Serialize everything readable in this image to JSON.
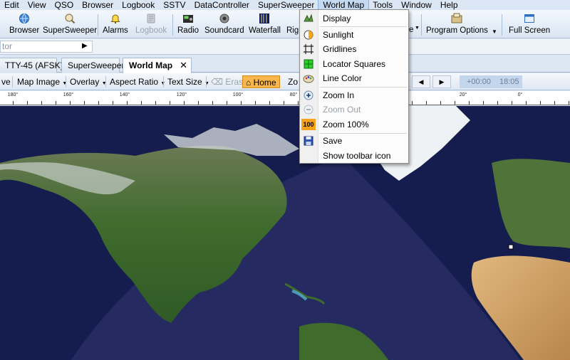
{
  "menubar": [
    "Edit",
    "View",
    "QSO",
    "Browser",
    "Logbook",
    "SSTV",
    "DataController",
    "SuperSweeper",
    "World Map",
    "Tools",
    "Window",
    "Help"
  ],
  "menubar_active": "World Map",
  "toolbar": {
    "browser": "Browser",
    "supersweeper": "SuperSweeper",
    "alarms": "Alarms",
    "logbook": "Logbook",
    "radio": "Radio",
    "soundcard": "Soundcard",
    "waterfall": "Waterfall",
    "rig": "Rig",
    "program_options": "Program Options",
    "full_screen": "Full Screen",
    "overflow_e": "e"
  },
  "address": {
    "placeholder": "tor"
  },
  "tabs": [
    "TTY-45 (AFSK)",
    "SuperSweeper",
    "World Map"
  ],
  "active_tab": "World Map",
  "map_toolbar": {
    "save": "ve",
    "map_image": "Map Image",
    "overlay": "Overlay",
    "aspect_ratio": "Aspect Ratio",
    "text_size": "Text Size",
    "erase": "Erase",
    "home": "Home",
    "zoom": "Zo",
    "time_offset": "+00:00",
    "time": "18:05"
  },
  "ruler_labels": [
    "180°",
    "160°",
    "140°",
    "120°",
    "100°",
    "80°",
    "20°",
    "0°"
  ],
  "world_map_menu": {
    "items": [
      {
        "label": "Display",
        "icon": "display-icon",
        "enabled": true
      },
      {
        "label": "Sunlight",
        "icon": "sunlight-icon",
        "enabled": true
      },
      {
        "label": "Gridlines",
        "icon": "gridlines-icon",
        "enabled": true
      },
      {
        "label": "Locator Squares",
        "icon": "locator-squares-icon",
        "enabled": true
      },
      {
        "label": "Line Color",
        "icon": "line-color-icon",
        "enabled": true
      },
      {
        "label": "Zoom In",
        "icon": "zoom-in-icon",
        "enabled": true
      },
      {
        "label": "Zoom Out",
        "icon": "zoom-out-icon",
        "enabled": false
      },
      {
        "label": "Zoom 100%",
        "icon": "zoom-100-icon",
        "enabled": true,
        "icon_text": "100"
      },
      {
        "label": "Save",
        "icon": "save-icon",
        "enabled": true
      },
      {
        "label": "Show toolbar icon",
        "icon": "",
        "enabled": true
      }
    ]
  },
  "colors": {
    "ocean": "#141d4d",
    "land_green": "#3f6b2d",
    "desert": "#d2a468",
    "ice": "#eef2f4",
    "home_button": "#f8b64c",
    "accent": "#c4daf3"
  }
}
